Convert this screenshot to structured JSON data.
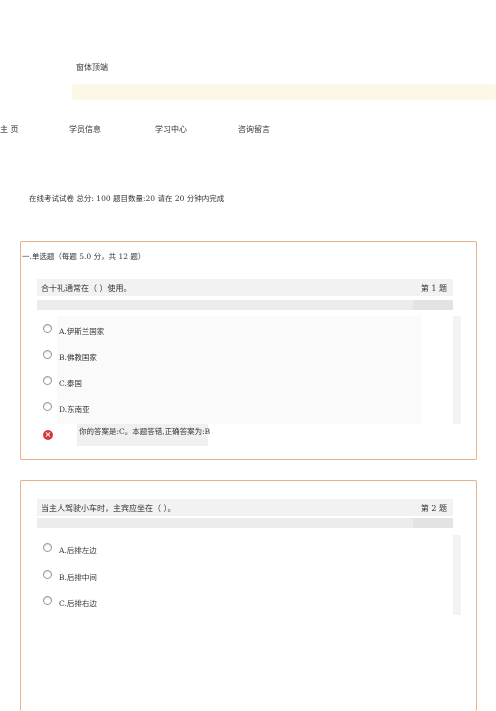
{
  "banner": {
    "title": "窗体顶端"
  },
  "nav": {
    "items": [
      {
        "label": "主 页"
      },
      {
        "label": "学员信息"
      },
      {
        "label": "学习中心"
      },
      {
        "label": "咨询留言"
      }
    ]
  },
  "exam_info": "在线考试试卷 总分: 100 题目数量:20 请在 20 分钟内完成",
  "sections": [
    {
      "title": "一.单选题（每题 5.0 分，共 12 题）",
      "question": {
        "text": "合十礼通常在（ ）使用。",
        "number": "第 1 题",
        "options": [
          {
            "label": "A.伊斯兰国家"
          },
          {
            "label": "B.佛教国家"
          },
          {
            "label": "C.泰国"
          },
          {
            "label": "D.东南亚"
          }
        ],
        "feedback": "你的答案是:C。本题答错,正确答案为:B",
        "feedback_icon": "error-icon"
      }
    },
    {
      "question": {
        "text": "当主人驾驶小车时，主宾应坐在（ ）。",
        "number": "第 2 题",
        "options": [
          {
            "label": "A.后排左边"
          },
          {
            "label": "B.后排中间"
          },
          {
            "label": "C.后排右边"
          }
        ]
      }
    }
  ],
  "colors": {
    "section_border": "#e9b08c",
    "banner_strip": "#fdf8e6",
    "error_icon": "#d9363e"
  }
}
